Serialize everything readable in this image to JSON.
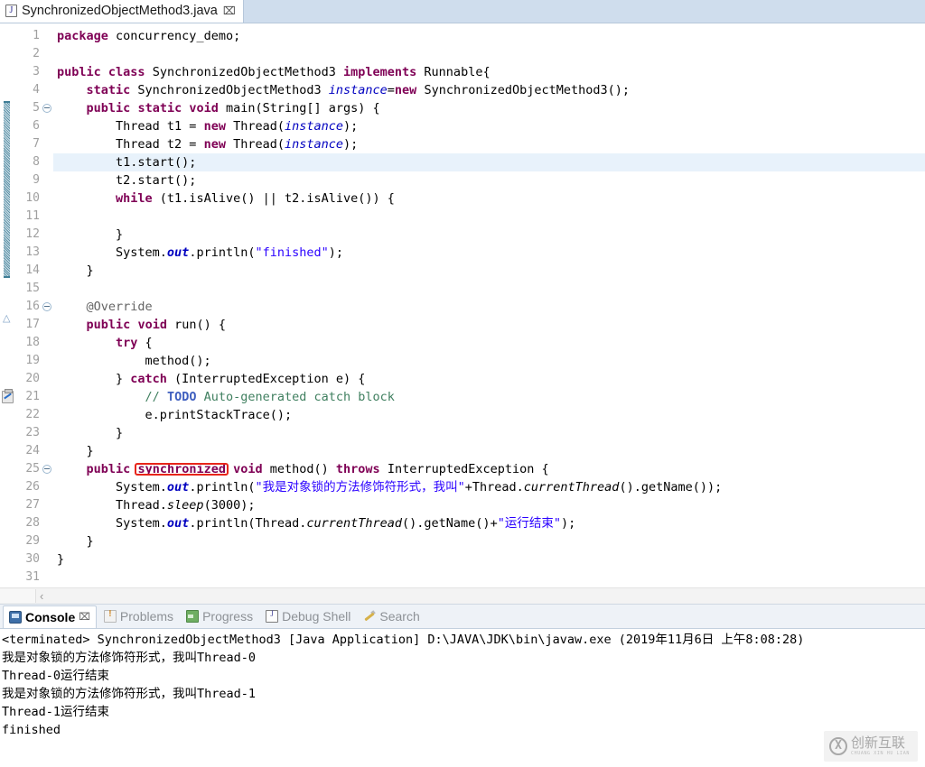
{
  "editor": {
    "tab": {
      "icon": "java-file-icon",
      "title": "SynchronizedObjectMethod3.java",
      "close_glyph": "⌧"
    },
    "current_line": 8,
    "fold_markers": [
      5,
      16,
      25
    ],
    "fold_range": {
      "from": 5,
      "to": 14
    },
    "override_marker_line": 17,
    "task_marker_line": 21,
    "annotation_box": {
      "target_text": "synchronized",
      "line": 25,
      "color": "#e8251a"
    },
    "line_numbers": [
      1,
      2,
      3,
      4,
      5,
      6,
      7,
      8,
      9,
      10,
      11,
      12,
      13,
      14,
      15,
      16,
      17,
      18,
      19,
      20,
      21,
      22,
      23,
      24,
      25,
      26,
      27,
      28,
      29,
      30,
      31
    ],
    "lines": [
      {
        "n": 1,
        "html": "<span class=\"kw\">package</span> concurrency_demo;"
      },
      {
        "n": 2,
        "html": ""
      },
      {
        "n": 3,
        "html": "<span class=\"kw\">public</span> <span class=\"kw\">class</span> SynchronizedObjectMethod3 <span class=\"kw\">implements</span> Runnable{"
      },
      {
        "n": 4,
        "html": "    <span class=\"kw\">static</span> SynchronizedObjectMethod3 <span class=\"fld\">instance</span>=<span class=\"kw\">new</span> SynchronizedObjectMethod3();"
      },
      {
        "n": 5,
        "html": "    <span class=\"kw\">public</span> <span class=\"kw\">static</span> <span class=\"kw\">void</span> main(String[] args) {"
      },
      {
        "n": 6,
        "html": "        Thread t1 = <span class=\"kw\">new</span> Thread(<span class=\"fld\">instance</span>);"
      },
      {
        "n": 7,
        "html": "        Thread t2 = <span class=\"kw\">new</span> Thread(<span class=\"fld\">instance</span>);"
      },
      {
        "n": 8,
        "html": "        t1.start();"
      },
      {
        "n": 9,
        "html": "        t2.start();"
      },
      {
        "n": 10,
        "html": "        <span class=\"kw\">while</span> (t1.isAlive() || t2.isAlive()) {"
      },
      {
        "n": 11,
        "html": ""
      },
      {
        "n": 12,
        "html": "        }"
      },
      {
        "n": 13,
        "html": "        System.<span class=\"sfld\">out</span>.println(<span class=\"str\">\"finished\"</span>);"
      },
      {
        "n": 14,
        "html": "    }"
      },
      {
        "n": 15,
        "html": ""
      },
      {
        "n": 16,
        "html": "    <span class=\"anno\">@Override</span>"
      },
      {
        "n": 17,
        "html": "    <span class=\"kw\">public</span> <span class=\"kw\">void</span> run() {"
      },
      {
        "n": 18,
        "html": "        <span class=\"kw\">try</span> {"
      },
      {
        "n": 19,
        "html": "            method();"
      },
      {
        "n": 20,
        "html": "        } <span class=\"kw\">catch</span> (InterruptedException e) {"
      },
      {
        "n": 21,
        "html": "            <span class=\"cmt\">// </span><span class=\"todo\">TODO</span><span class=\"cmt\"> Auto-generated catch block</span>"
      },
      {
        "n": 22,
        "html": "            e.printStackTrace();"
      },
      {
        "n": 23,
        "html": "        }"
      },
      {
        "n": 24,
        "html": "    }"
      },
      {
        "n": 25,
        "html": "    <span class=\"kw\">public</span> <span class=\"kw\" id=\"sync-kw\">synchronized</span> <span class=\"kw\">void</span> method() <span class=\"kw\">throws</span> InterruptedException {"
      },
      {
        "n": 26,
        "html": "        System.<span class=\"sfld\">out</span>.println(<span class=\"str\">\"我是对象锁的方法修饰符形式，我叫\"</span>+Thread.<span class=\"mth\">currentThread</span>().getName());"
      },
      {
        "n": 27,
        "html": "        Thread.<span class=\"mth\">sleep</span>(3000);"
      },
      {
        "n": 28,
        "html": "        System.<span class=\"sfld\">out</span>.println(Thread.<span class=\"mth\">currentThread</span>().getName()+<span class=\"str\">\"运行结束\"</span>);"
      },
      {
        "n": 29,
        "html": "    }"
      },
      {
        "n": 30,
        "html": "}"
      },
      {
        "n": 31,
        "html": ""
      }
    ]
  },
  "console_panel": {
    "tabs": [
      {
        "label": "Console",
        "icon": "console-icon",
        "active": true,
        "closable": true,
        "close_glyph": "⌧"
      },
      {
        "label": "Problems",
        "icon": "problems-icon",
        "active": false,
        "closable": false
      },
      {
        "label": "Progress",
        "icon": "progress-icon",
        "active": false,
        "closable": false
      },
      {
        "label": "Debug Shell",
        "icon": "debug-shell-icon",
        "active": false,
        "closable": false
      },
      {
        "label": "Search",
        "icon": "search-icon",
        "active": false,
        "closable": false
      }
    ],
    "process_header": "<terminated> SynchronizedObjectMethod3 [Java Application] D:\\JAVA\\JDK\\bin\\javaw.exe (2019年11月6日 上午8:08:28)",
    "output_lines": [
      "我是对象锁的方法修饰符形式，我叫Thread-0",
      "Thread-0运行结束",
      "我是对象锁的方法修饰符形式，我叫Thread-1",
      "Thread-1运行结束",
      "finished"
    ]
  },
  "scrollbar": {
    "left_arrow_glyph": "‹"
  },
  "watermark": {
    "cn_text": "创新互联",
    "en_text": "CHUANG XIN HU LIAN",
    "mark_glyph": "X"
  },
  "colors": {
    "keyword": "#7f0055",
    "string": "#2a00ff",
    "comment": "#3f7f5f",
    "todo": "#3f5fbf",
    "field": "#0000c0",
    "annotation_box": "#e8251a",
    "current_line_bg": "#e8f2fb",
    "tab_strip_bg": "#cfdded"
  }
}
